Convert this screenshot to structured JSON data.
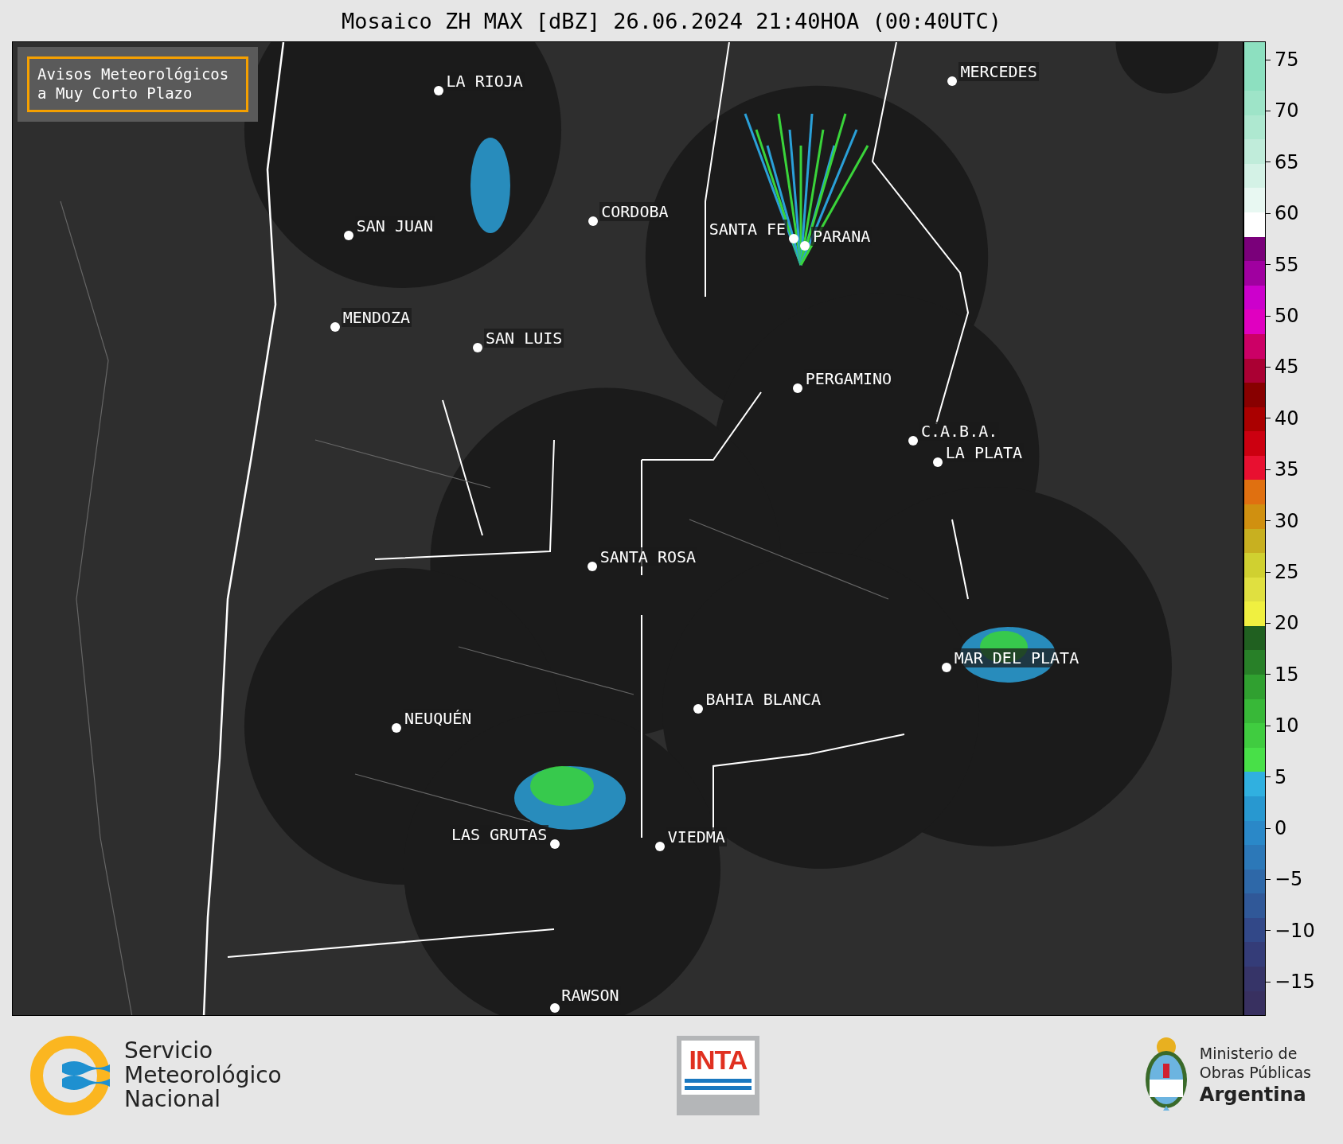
{
  "title": "Mosaico ZH MAX [dBZ] 26.06.2024 21:40HOA (00:40UTC)",
  "notice": "Avisos Meteorológicos a Muy Corto Plazo",
  "cities": [
    "LA RIOJA",
    "MERCEDES",
    "CORDOBA",
    "SAN JUAN",
    "SANTA FE",
    "PARANA",
    "MENDOZA",
    "SAN LUIS",
    "PERGAMINO",
    "C.A.B.A.",
    "LA PLATA",
    "SANTA ROSA",
    "MAR DEL PLATA",
    "BAHIA BLANCA",
    "NEUQUÉN",
    "LAS GRUTAS",
    "VIEDMA",
    "RAWSON"
  ],
  "colorbar_ticks": [
    "75",
    "70",
    "65",
    "60",
    "55",
    "50",
    "45",
    "40",
    "35",
    "30",
    "25",
    "20",
    "15",
    "10",
    "5",
    "0",
    "−5",
    "−10",
    "−15"
  ],
  "logos": {
    "smn": "Servicio Meteorológico Nacional",
    "inta": "INTA",
    "ministry": [
      "Ministerio de",
      "Obras Públicas",
      "Argentina"
    ]
  }
}
